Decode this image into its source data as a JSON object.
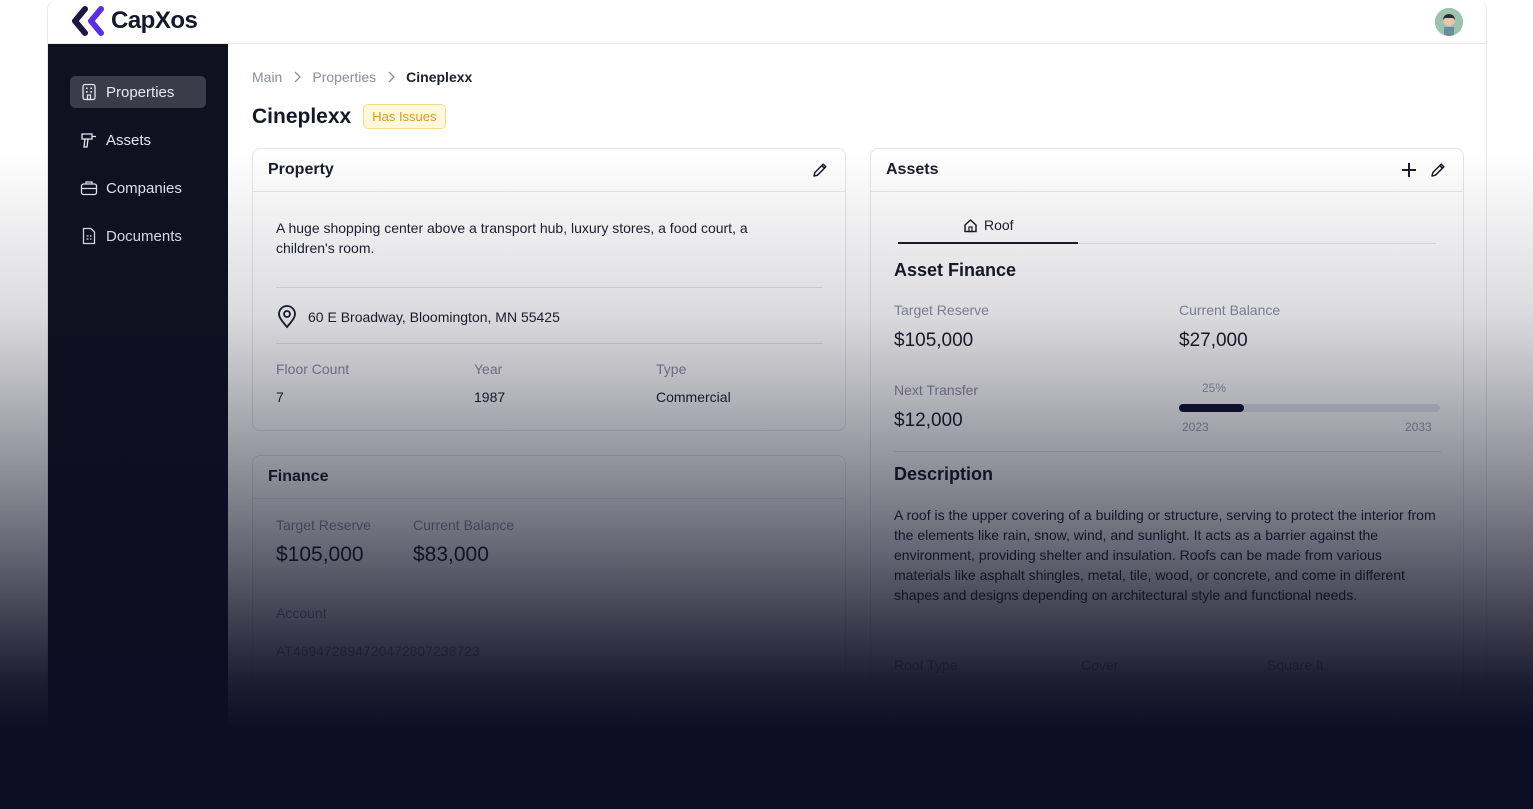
{
  "app": {
    "name": "CapXos"
  },
  "sidebar": {
    "items": [
      {
        "label": "Properties",
        "icon": "building-icon",
        "active": true
      },
      {
        "label": "Assets",
        "icon": "drill-icon",
        "active": false
      },
      {
        "label": "Companies",
        "icon": "briefcase-icon",
        "active": false
      },
      {
        "label": "Documents",
        "icon": "document-icon",
        "active": false
      }
    ]
  },
  "breadcrumb": [
    "Main",
    "Properties",
    "Cineplexx"
  ],
  "page": {
    "title": "Cineplexx",
    "status_badge": "Has Issues"
  },
  "property_card": {
    "title": "Property",
    "description": "A huge shopping center above a transport hub, luxury stores, a food court, a children's room.",
    "address": "60 E Broadway, Bloomington, MN 55425",
    "fields": [
      {
        "label": "Floor Count",
        "value": "7"
      },
      {
        "label": "Year",
        "value": "1987"
      },
      {
        "label": "Type",
        "value": "Commercial"
      }
    ]
  },
  "finance_card": {
    "title": "Finance",
    "target_reserve_label": "Target Reserve",
    "target_reserve": "$105,000",
    "current_balance_label": "Current Balance",
    "current_balance": "$83,000",
    "account_label": "Account",
    "account": "AT46947289472047280723872​3"
  },
  "assets_card": {
    "title": "Assets",
    "tab": "Roof",
    "asset_finance_title": "Asset Finance",
    "target_reserve_label": "Target Reserve",
    "target_reserve": "$105,000",
    "current_balance_label": "Current Balance",
    "current_balance": "$27,000",
    "next_transfer_label": "Next Transfer",
    "next_transfer": "$12,000",
    "progress_label": "25%",
    "progress": 0.25,
    "progress_start": "2023",
    "progress_end": "2033",
    "description_title": "Description",
    "description": "A roof is the upper covering of a building or structure, serving to protect the interior from the elements like rain, snow, wind, and sunlight. It acts as a barrier against the environment, providing shelter and insulation. Roofs can be made from various materials like asphalt shingles, metal, tile,  wood, or concrete, and come in different shapes and designs depending on architectural style and functional needs.",
    "details_headers": [
      "Roof Type",
      "Cover",
      "Square ft"
    ]
  },
  "colors": {
    "sidebar": "#0f1020",
    "accent": "#5b2ee6",
    "badge": "#d79a1b"
  }
}
